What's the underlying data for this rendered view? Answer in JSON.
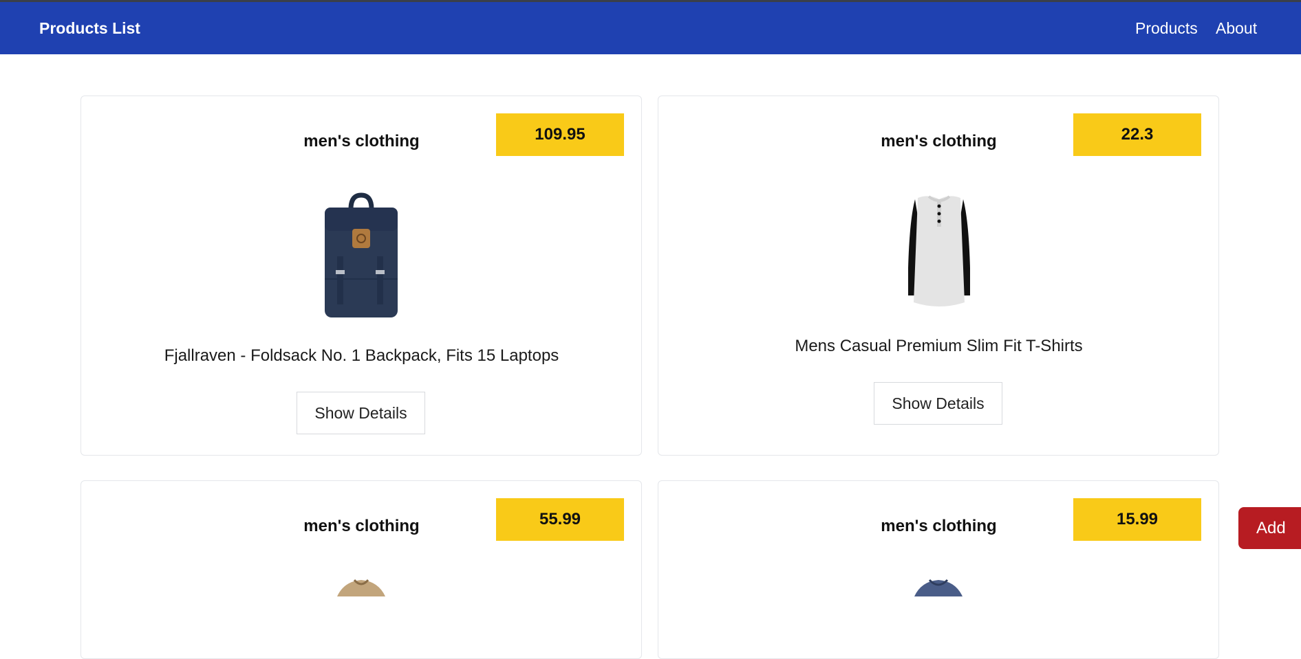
{
  "navbar": {
    "brand": "Products List",
    "links": [
      {
        "label": "Products"
      },
      {
        "label": "About"
      }
    ]
  },
  "products": [
    {
      "category": "men's clothing",
      "price": "109.95",
      "title": "Fjallraven - Foldsack No. 1 Backpack, Fits 15 Laptops",
      "button_label": "Show Details"
    },
    {
      "category": "men's clothing",
      "price": "22.3",
      "title": "Mens Casual Premium Slim Fit T-Shirts",
      "button_label": "Show Details"
    },
    {
      "category": "men's clothing",
      "price": "55.99"
    },
    {
      "category": "men's clothing",
      "price": "15.99"
    }
  ],
  "add_button": {
    "label": "Add"
  },
  "colors": {
    "navbar": "#1f41b1",
    "price_badge": "#f9ca18",
    "add_button": "#b71c22"
  }
}
